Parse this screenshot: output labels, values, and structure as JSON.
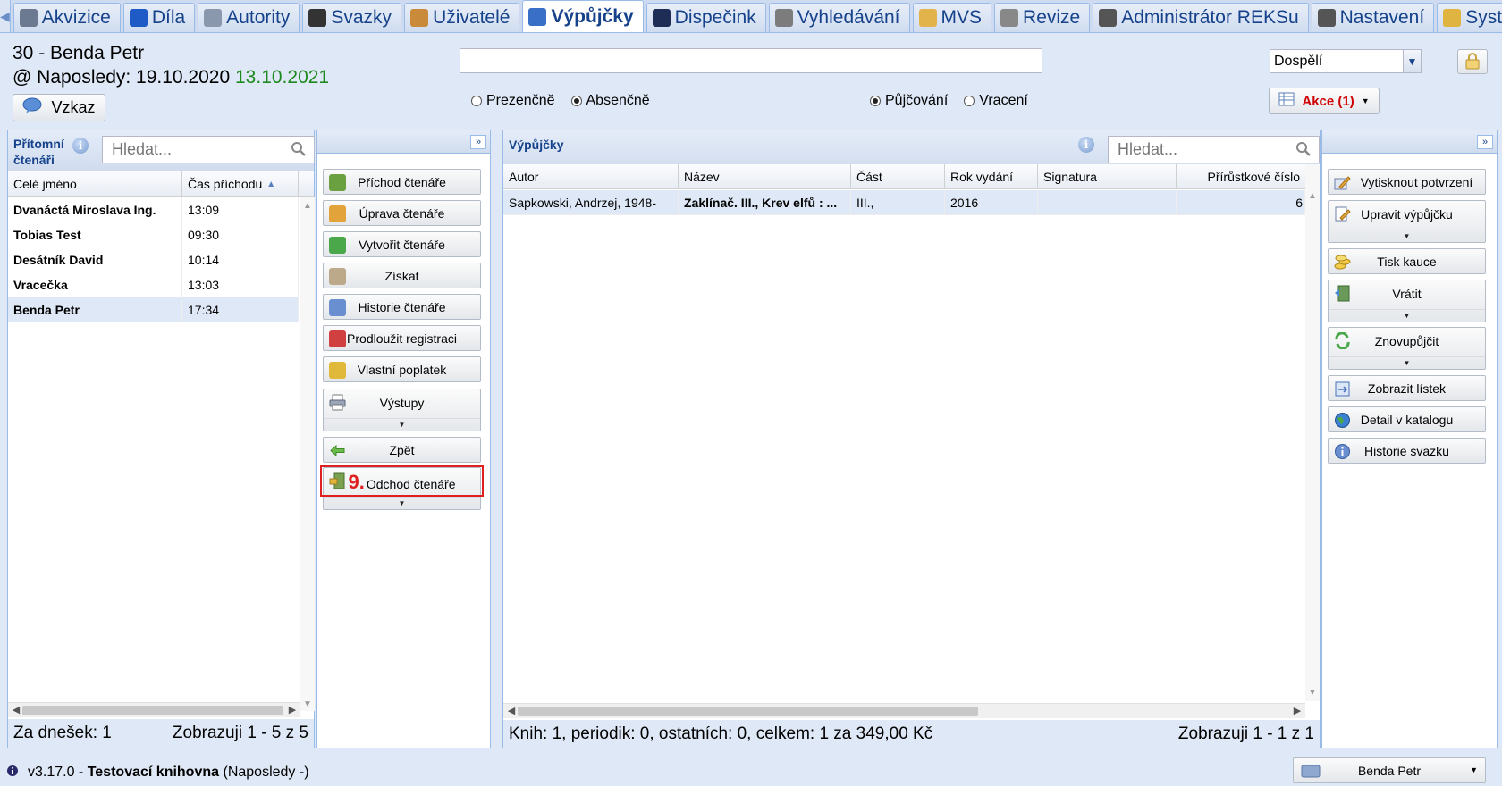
{
  "tabs": [
    {
      "label": "Akvizice",
      "icon": "cart-icon",
      "color": "#6b7a90"
    },
    {
      "label": "Díla",
      "icon": "book-icon",
      "color": "#1e5bc6"
    },
    {
      "label": "Autority",
      "icon": "card-icon",
      "color": "#8a98ad"
    },
    {
      "label": "Svazky",
      "icon": "pen-icon",
      "color": "#333"
    },
    {
      "label": "Uživatelé",
      "icon": "users-icon",
      "color": "#c98a3a"
    },
    {
      "label": "Výpůjčky",
      "icon": "books-icon",
      "color": "#3a6fc8",
      "active": true
    },
    {
      "label": "Dispečink",
      "icon": "monitor-icon",
      "color": "#1d2d56"
    },
    {
      "label": "Vyhledávání",
      "icon": "search-doc-icon",
      "color": "#7c7c7c"
    },
    {
      "label": "MVS",
      "icon": "package-icon",
      "color": "#e2b34a"
    },
    {
      "label": "Revize",
      "icon": "document-icon",
      "color": "#888"
    },
    {
      "label": "Administrátor REKSu",
      "icon": "tools-icon",
      "color": "#555"
    },
    {
      "label": "Nastavení",
      "icon": "wrench-icon",
      "color": "#555"
    },
    {
      "label": "Systém",
      "icon": "key-icon",
      "color": "#e0b440"
    }
  ],
  "header": {
    "reader_name": "30 - Benda Petr",
    "last_visit_label": "@ Naposledy: 19.10.2020",
    "last_visit_date": "13.10.2021",
    "message_button": "Vzkaz",
    "search_value": "",
    "mode_presence": "Prezenčně",
    "mode_absence": "Absenčně",
    "mode_lending": "Půjčování",
    "mode_return": "Vracení",
    "category_select": "Dospělí",
    "actions_button": "Akce (1)"
  },
  "present_readers": {
    "title_line1": "Přítomní",
    "title_line2": "čtenáři",
    "search_placeholder": "Hledat...",
    "columns": [
      "Celé jméno",
      "Čas příchodu"
    ],
    "rows": [
      {
        "name": "Dvanáctá Miroslava Ing.",
        "time": "13:09"
      },
      {
        "name": "Tobias Test",
        "time": "09:30"
      },
      {
        "name": "Desátník David",
        "time": "10:14"
      },
      {
        "name": "Vracečka",
        "time": "13:03"
      },
      {
        "name": "Benda Petr",
        "time": "17:34",
        "selected": true
      }
    ],
    "footer_left": "Za dnešek: 1",
    "footer_right": "Zobrazuji 1 - 5 z 5"
  },
  "reader_actions": {
    "buttons": [
      {
        "label": "Příchod čtenáře",
        "icon": "reader-arrive-icon",
        "color": "#6aa040"
      },
      {
        "label": "Úprava čtenáře",
        "icon": "pencil-icon",
        "color": "#e2a33a"
      },
      {
        "label": "Vytvořit čtenáře",
        "icon": "add-icon",
        "color": "#4aa84a"
      },
      {
        "label": "Získat",
        "icon": "get-icon",
        "color": "#bca98a"
      },
      {
        "label": "Historie čtenáře",
        "icon": "info-icon",
        "color": "#6a8fd0"
      },
      {
        "label": "Prodloužit registraci",
        "icon": "calendar-icon",
        "color": "#d04040"
      },
      {
        "label": "Vlastní poplatek",
        "icon": "coins-icon",
        "color": "#e0b93a"
      }
    ],
    "outputs": "Výstupy",
    "back": "Zpět",
    "leave": "Odchod čtenáře",
    "step_label": "9."
  },
  "loans": {
    "title": "Výpůjčky",
    "search_placeholder": "Hledat...",
    "columns": [
      "Autor",
      "Název",
      "Část",
      "Rok vydání",
      "Signatura",
      "Přírůstkové číslo"
    ],
    "rows": [
      {
        "author": "Sapkowski, Andrzej, 1948-",
        "title": "Zaklínač. III., Krev elfů : ...",
        "part": "III.,",
        "year": "2016",
        "signature": "",
        "accession": "6"
      }
    ],
    "footer_left": "Knih: 1, periodik: 0, ostatních: 0, celkem: 1 za 349,00 Kč",
    "footer_right": "Zobrazuji 1 - 1 z 1"
  },
  "loan_actions": {
    "print_confirmation": "Vytisknout potvrzení",
    "edit_loan": "Upravit výpůjčku",
    "print_deposit": "Tisk kauce",
    "return": "Vrátit",
    "renew": "Znovupůjčit",
    "show_slip": "Zobrazit lístek",
    "catalog_detail": "Detail v katalogu",
    "volume_history": "Historie svazku"
  },
  "status": {
    "version": "v3.17.0 -",
    "library": "Testovací knihovna",
    "suffix": "(Naposledy -)",
    "reader_button": "Benda Petr"
  }
}
